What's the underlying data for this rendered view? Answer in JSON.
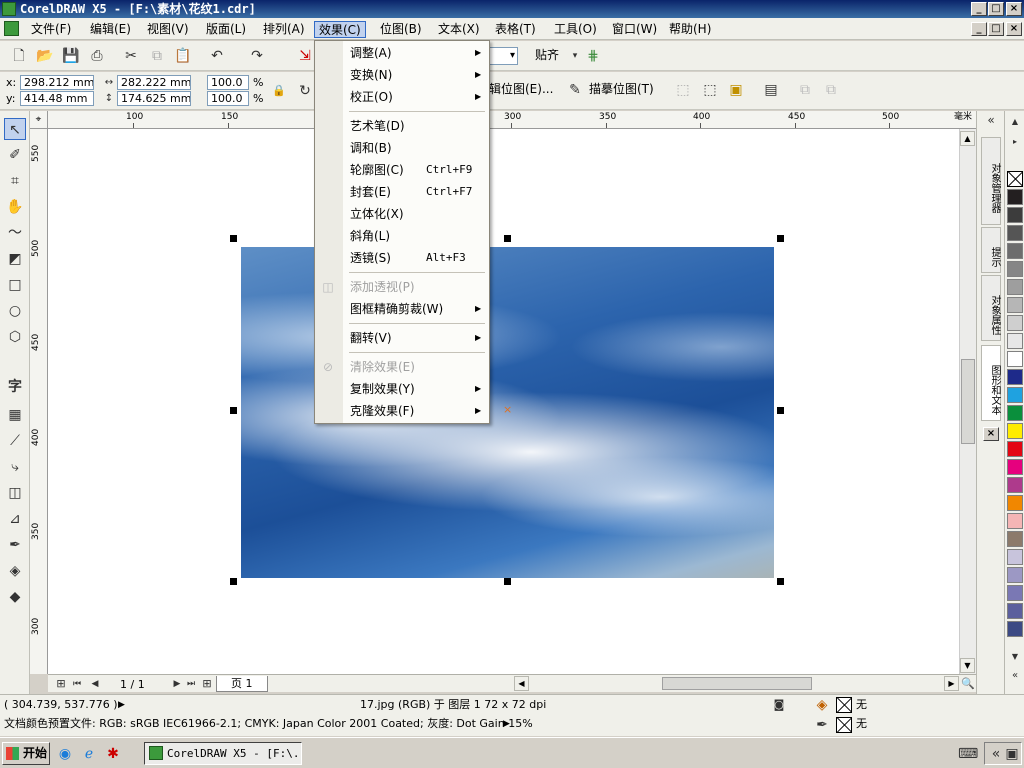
{
  "window": {
    "title": "CorelDRAW X5 - [F:\\素材\\花纹1.cdr]",
    "controls": {
      "minimize": "_",
      "maximize": "□",
      "close": "×"
    }
  },
  "menubar": {
    "items": [
      "文件(F)",
      "编辑(E)",
      "视图(V)",
      "版面(L)",
      "排列(A)",
      "效果(C)",
      "位图(B)",
      "文本(X)",
      "表格(T)",
      "工具(O)",
      "窗口(W)",
      "帮助(H)"
    ],
    "active_index": 5
  },
  "standard_toolbar": {
    "snap_label": "贴齐"
  },
  "property_bar": {
    "x_label": "x:",
    "x_value": "298.212 mm",
    "y_label": "y:",
    "y_value": "414.48 mm",
    "width_value": "282.222 mm",
    "height_value": "174.625 mm",
    "scale_x": "100.0",
    "scale_y": "100.0",
    "percent": "%",
    "edit_bitmap_label": "辑位图(E)...",
    "trace_bitmap_label": "描摹位图(T)"
  },
  "rulers": {
    "horizontal_ticks": [
      "100",
      "150",
      "300",
      "350",
      "400",
      "450",
      "500"
    ],
    "unit_label": "毫米",
    "vertical_ticks": [
      "550",
      "500",
      "450",
      "400",
      "350",
      "300"
    ]
  },
  "effects_menu": {
    "items": [
      {
        "label": "调整(A)",
        "submenu": true
      },
      {
        "label": "变换(N)",
        "submenu": true
      },
      {
        "label": "校正(O)",
        "submenu": true
      },
      {
        "label": "艺术笔(D)"
      },
      {
        "label": "调和(B)"
      },
      {
        "label": "轮廓图(C)",
        "shortcut": "Ctrl+F9"
      },
      {
        "label": "封套(E)",
        "shortcut": "Ctrl+F7"
      },
      {
        "label": "立体化(X)"
      },
      {
        "label": "斜角(L)"
      },
      {
        "label": "透镜(S)",
        "shortcut": "Alt+F3"
      },
      {
        "label": "添加透视(P)",
        "disabled": true
      },
      {
        "label": "图框精确剪裁(W)",
        "submenu": true
      },
      {
        "label": "翻转(V)",
        "submenu": true
      },
      {
        "label": "清除效果(E)",
        "disabled": true
      },
      {
        "label": "复制效果(Y)",
        "submenu": true
      },
      {
        "label": "克隆效果(F)",
        "submenu": true
      }
    ]
  },
  "page_nav": {
    "counter": "1 / 1",
    "page_tab": "页 1"
  },
  "docker": {
    "tabs": [
      "对象管理器",
      "提示",
      "对象属性",
      "图形和文本"
    ]
  },
  "palette": {
    "colors": [
      "#231f20",
      "#3c3c3c",
      "#555555",
      "#6d6d6d",
      "#868686",
      "#9e9e9e",
      "#b6b6b6",
      "#cfcfcf",
      "#e7e7e7",
      "#ffffff",
      "#1e2a8a",
      "#1fa2e0",
      "#0a8f3c",
      "#ffec00",
      "#e30613",
      "#e6007e",
      "#ae3a8c",
      "#f18700",
      "#f5b5b5",
      "#8c7a6b",
      "#c8c4dc",
      "#9c98c4",
      "#7a78b4",
      "#5b5f9d",
      "#3c4a84"
    ]
  },
  "status": {
    "cursor_position": "( 304.739, 537.776 )",
    "object_info": "17.jpg (RGB) 于 图层 1 72 x 72 dpi",
    "fill_label": "无",
    "outline_label": "无",
    "color_profile": "文档颜色预置文件: RGB: sRGB IEC61966-2.1; CMYK: Japan Color 2001 Coated; 灰度: Dot Gain 15%"
  },
  "taskbar": {
    "start_label": "开始",
    "task_label": "CorelDRAW X5 - [F:\\..."
  }
}
